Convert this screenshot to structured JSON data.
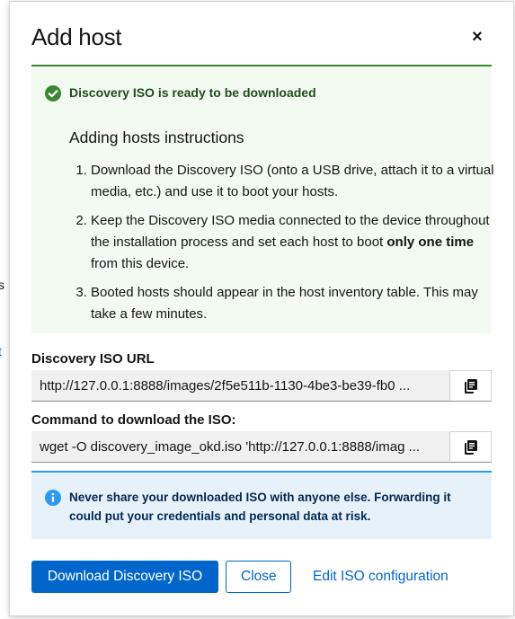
{
  "background": {
    "text1": "s",
    "text2": "t"
  },
  "modal": {
    "title": "Add host",
    "close_glyph": "×",
    "success_alert": {
      "title": "Discovery ISO is ready to be downloaded",
      "icon": "check-circle-icon",
      "color": "#3e8635"
    },
    "instructions": {
      "title": "Adding hosts instructions",
      "steps": [
        {
          "text": "Download the Discovery ISO (onto a USB drive, attach it to a virtual media, etc.) and use it to boot your hosts."
        },
        {
          "pre": "Keep the Discovery ISO media connected to the device throughout the installation process and set each host to boot ",
          "bold": "only one time",
          "post": " from this device."
        },
        {
          "text": "Booted hosts should appear in the host inventory table. This may take a few minutes."
        }
      ]
    },
    "iso_url": {
      "label": "Discovery ISO URL",
      "value": "http://127.0.0.1:8888/images/2f5e511b-1130-4be3-be39-fb0 ..."
    },
    "iso_command": {
      "label": "Command to download the ISO:",
      "value": "wget -O discovery_image_okd.iso 'http://127.0.0.1:8888/imag ..."
    },
    "info_alert": {
      "text": "Never share your downloaded ISO with anyone else. Forwarding it could put your credentials and personal data at risk.",
      "icon": "info-circle-icon",
      "color": "#2b9af3"
    },
    "footer": {
      "download_label": "Download Discovery ISO",
      "close_label": "Close",
      "edit_label": "Edit ISO configuration"
    },
    "accent_color": "#0066cc"
  }
}
